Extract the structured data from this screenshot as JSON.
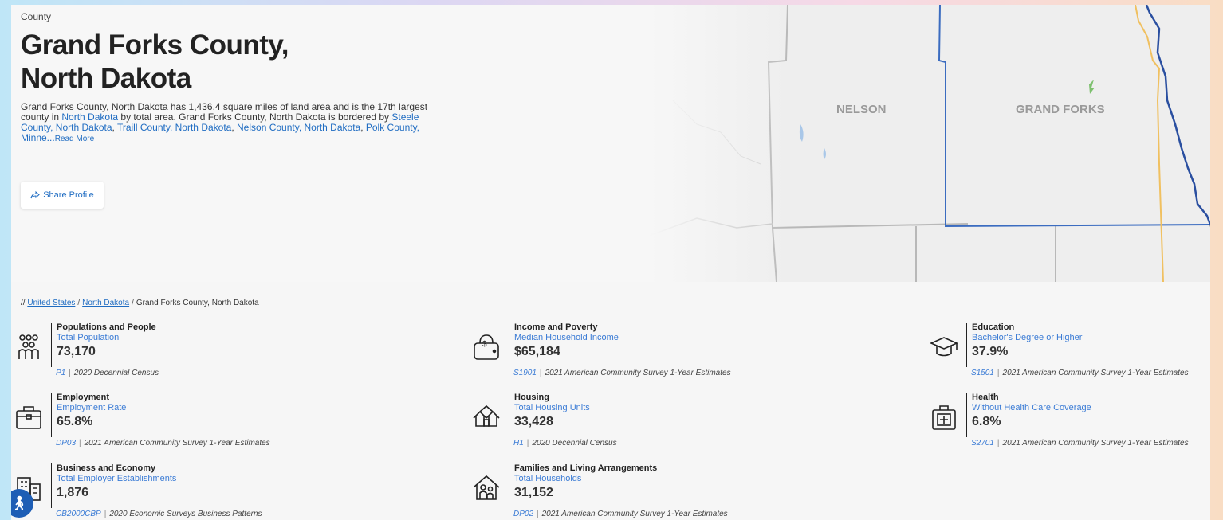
{
  "hero": {
    "eyebrow": "County",
    "title_line1": "Grand Forks County,",
    "title_line2": "North Dakota",
    "desc_1": "Grand Forks County, North Dakota has 1,436.4 square miles of land area and is the 17th largest county in ",
    "desc_link_state": "North Dakota",
    "desc_2": " by total area. Grand Forks County, North Dakota is bordered by ",
    "desc_link_1": "Steele County, North Dakota",
    "desc_link_2": "Traill County, North Dakota",
    "desc_link_3": "Nelson County, North Dakota",
    "desc_link_4": "Polk County, Minne...",
    "read_more": "Read More",
    "share_label": "Share Profile"
  },
  "map": {
    "label_left": "NELSON",
    "label_right": "GRAND FORKS"
  },
  "breadcrumb": {
    "prefix": "//",
    "item1": "United States",
    "item2": "North Dakota",
    "item3": "Grand Forks County, North Dakota"
  },
  "stats": [
    {
      "category": "Populations and People",
      "metric": "Total Population",
      "value": "73,170",
      "code": "P1",
      "source": "2020 Decennial Census",
      "icon": "people-icon"
    },
    {
      "category": "Income and Poverty",
      "metric": "Median Household Income",
      "value": "$65,184",
      "code": "S1901",
      "source": "2021 American Community Survey 1-Year Estimates",
      "icon": "money-bag-icon"
    },
    {
      "category": "Education",
      "metric": "Bachelor's Degree or Higher",
      "value": "37.9%",
      "code": "S1501",
      "source": "2021 American Community Survey 1-Year Estimates",
      "icon": "graduation-cap-icon"
    },
    {
      "category": "Employment",
      "metric": "Employment Rate",
      "value": "65.8%",
      "code": "DP03",
      "source": "2021 American Community Survey 1-Year Estimates",
      "icon": "briefcase-icon"
    },
    {
      "category": "Housing",
      "metric": "Total Housing Units",
      "value": "33,428",
      "code": "H1",
      "source": "2020 Decennial Census",
      "icon": "houses-icon"
    },
    {
      "category": "Health",
      "metric": "Without Health Care Coverage",
      "value": "6.8%",
      "code": "S2701",
      "source": "2021 American Community Survey 1-Year Estimates",
      "icon": "medical-kit-icon"
    },
    {
      "category": "Business and Economy",
      "metric": "Total Employer Establishments",
      "value": "1,876",
      "code": "CB2000CBP",
      "source": "2020 Economic Surveys Business Patterns",
      "icon": "buildings-icon"
    },
    {
      "category": "Families and Living Arrangements",
      "metric": "Total Households",
      "value": "31,152",
      "code": "DP02",
      "source": "2021 American Community Survey 1-Year Estimates",
      "icon": "family-house-icon"
    }
  ],
  "colors": {
    "link": "#1f6cc2",
    "county_border": "#3b6cc0",
    "state_border": "#2a4fa0",
    "highway": "#f0c060"
  }
}
